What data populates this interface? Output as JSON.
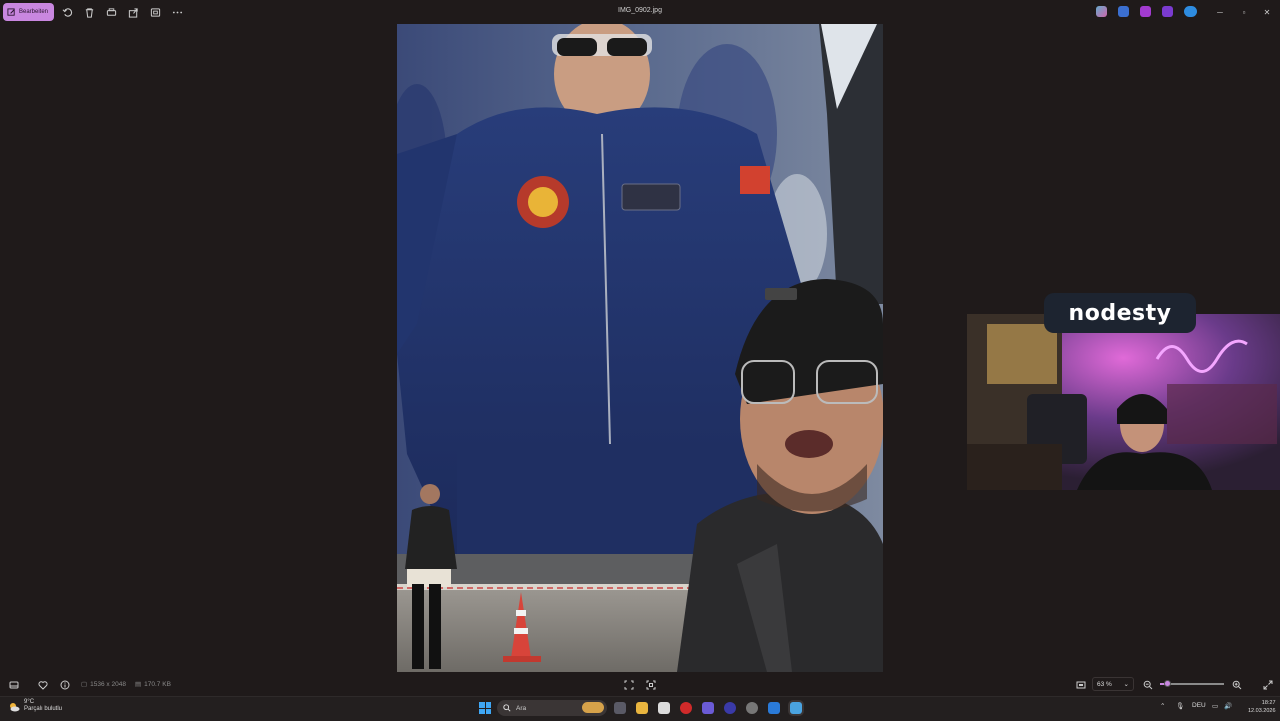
{
  "toolbar": {
    "edit_label": "Bearbeiten",
    "icons": [
      "rotate-icon",
      "delete-icon",
      "print-icon",
      "share-icon",
      "slideshow-icon",
      "more-icon"
    ]
  },
  "window": {
    "title": "IMG_0902.jpg"
  },
  "overlay": {
    "logo_text": "nodesty"
  },
  "status": {
    "dimensions": "1536 x 2048",
    "file_size": "170.7 KB",
    "zoom": "63 %",
    "zoom_level": 0.12
  },
  "taskbar": {
    "weather_temp": "9°C",
    "weather_desc": "Parçalı bulutlu",
    "search_placeholder": "Ara",
    "language": "DEU",
    "time": "18:27",
    "date": "12.03.2026"
  },
  "colors": {
    "accent": "#c987e0",
    "background": "#1f1a1a",
    "taskbar": "#231f1f"
  }
}
